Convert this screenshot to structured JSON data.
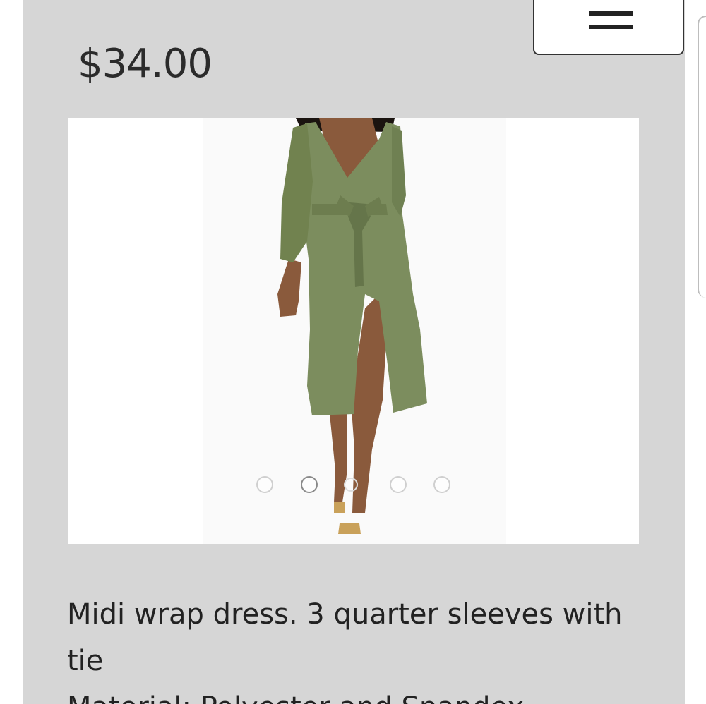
{
  "product": {
    "price": "$34.00",
    "description": "Midi wrap dress. 3 quarter sleeves with tie",
    "material": "Material: Polyester and Spandex"
  },
  "menu": {
    "icon": "hamburger-menu-icon"
  },
  "gallery": {
    "image": "olive green midi wrap dress with tie waist",
    "dress_color": "#7c8d5e",
    "dots": [
      {
        "state": "inactive"
      },
      {
        "state": "active"
      },
      {
        "state": "inactive"
      },
      {
        "state": "inactive"
      },
      {
        "state": "inactive"
      }
    ]
  },
  "colors": {
    "panel_background": "#d6d6d6",
    "text": "#222222"
  }
}
